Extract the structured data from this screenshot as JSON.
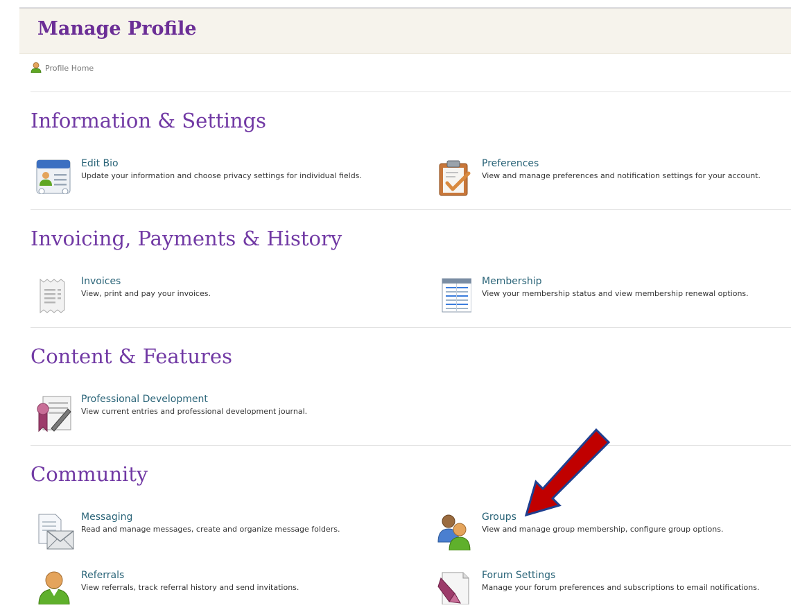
{
  "header": {
    "title": "Manage Profile"
  },
  "breadcrumb": {
    "label": "Profile Home",
    "icon": "user-icon"
  },
  "sections": [
    {
      "heading": "Information & Settings",
      "items": [
        {
          "title": "Edit Bio",
          "description": "Update your information and choose privacy settings for individual fields.",
          "icon": "id-card-icon"
        },
        {
          "title": "Preferences",
          "description": "View and manage preferences and notification settings for your account.",
          "icon": "clipboard-check-icon"
        }
      ]
    },
    {
      "heading": "Invoicing, Payments & History",
      "items": [
        {
          "title": "Invoices",
          "description": "View, print and pay your invoices.",
          "icon": "receipt-icon"
        },
        {
          "title": "Membership",
          "description": "View your membership status and view membership renewal options.",
          "icon": "spreadsheet-icon"
        }
      ]
    },
    {
      "heading": "Content & Features",
      "items": [
        {
          "title": "Professional Development",
          "description": "View current entries and professional development journal.",
          "icon": "certificate-pen-icon"
        }
      ]
    },
    {
      "heading": "Community",
      "items": [
        {
          "title": "Messaging",
          "description": "Read and manage messages, create and organize message folders.",
          "icon": "envelope-document-icon"
        },
        {
          "title": "Groups",
          "description": "View and manage group membership, configure group options.",
          "icon": "group-users-icon"
        },
        {
          "title": "Referrals",
          "description": "View referrals, track referral history and send invitations.",
          "icon": "user-icon"
        },
        {
          "title": "Forum Settings",
          "description": "Manage your forum preferences and subscriptions to email notifications.",
          "icon": "forum-page-icon"
        }
      ]
    }
  ],
  "annotation": {
    "color": "#c00000",
    "outline": "#1f3f8f"
  }
}
